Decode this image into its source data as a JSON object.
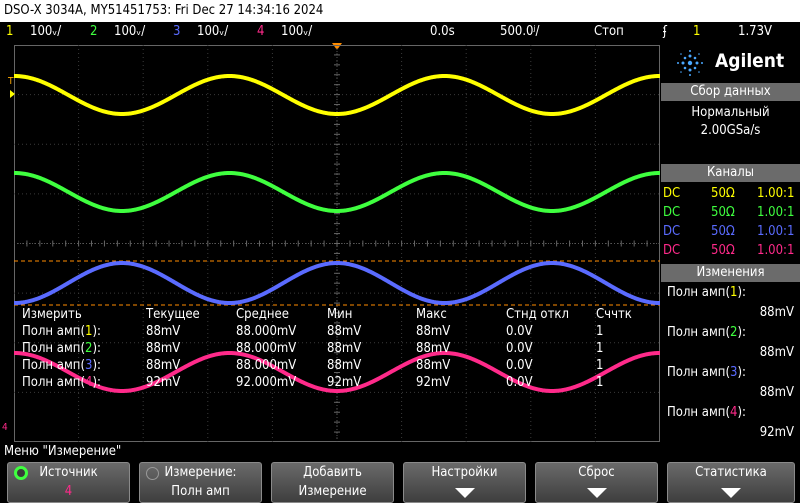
{
  "title": "DSO-X 3034A, MY51451753: Fri Dec 27 14:34:16 2024",
  "status": {
    "ch1_num": "1",
    "ch1_scale": "100ᵥ/",
    "ch2_num": "2",
    "ch2_scale": "100ᵥ/",
    "ch3_num": "3",
    "ch3_scale": "100ᵥ/",
    "ch4_num": "4",
    "ch4_scale": "100ᵥ/",
    "time_pos": "0.0s",
    "time_scale": "500.0ʲ/",
    "run_state": "Стоп",
    "trig_icon": "ʄ",
    "trig_src": "1",
    "trig_level": "1.73V"
  },
  "colors": {
    "ch1": "#ffff00",
    "ch2": "#3fff3f",
    "ch3": "#5a6bff",
    "ch4": "#ff2a8a",
    "trigger_marker": "#ff8c00",
    "panel_header": "#6b6b6b"
  },
  "side_panel": {
    "logo": "Agilent",
    "acq_header": "Сбор данных",
    "acq_mode": "Нормальный",
    "acq_rate": "2.00GSa/s",
    "channels_header": "Каналы",
    "channels": [
      {
        "coupling": "DC",
        "imp": "50Ω",
        "probe": "1.00:1"
      },
      {
        "coupling": "DC",
        "imp": "50Ω",
        "probe": "1.00:1"
      },
      {
        "coupling": "DC",
        "imp": "50Ω",
        "probe": "1.00:1"
      },
      {
        "coupling": "DC",
        "imp": "50Ω",
        "probe": "1.00:1"
      }
    ],
    "meas_header": "Изменения",
    "meas_items": [
      {
        "label": "Полн амп",
        "ch": "1",
        "value": "88mV"
      },
      {
        "label": "Полн амп",
        "ch": "2",
        "value": "88mV"
      },
      {
        "label": "Полн амп",
        "ch": "3",
        "value": "88mV"
      },
      {
        "label": "Полн амп",
        "ch": "4",
        "value": "92mV"
      }
    ]
  },
  "meas_table": {
    "headers": [
      "Измерить",
      "Текущее",
      "Среднее",
      "Мин",
      "Макс",
      "Стнд откл",
      "Сччтк"
    ],
    "rows": [
      {
        "label": "Полн амп",
        "ch": "1",
        "cur": "88mV",
        "avg": "88.000mV",
        "min": "88mV",
        "max": "88mV",
        "std": "0.0V",
        "cnt": "1"
      },
      {
        "label": "Полн амп",
        "ch": "2",
        "cur": "88mV",
        "avg": "88.000mV",
        "min": "88mV",
        "max": "88mV",
        "std": "0.0V",
        "cnt": "1"
      },
      {
        "label": "Полн амп",
        "ch": "3",
        "cur": "88mV",
        "avg": "88.000mV",
        "min": "88mV",
        "max": "88mV",
        "std": "0.0V",
        "cnt": "1"
      },
      {
        "label": "Полн амп",
        "ch": "4",
        "cur": "92mV",
        "avg": "92.000mV",
        "min": "92mV",
        "max": "92mV",
        "std": "0.0V",
        "cnt": "1"
      }
    ]
  },
  "menu_title": "Меню \"Измерение\"",
  "softkeys": [
    {
      "line1": "Источник",
      "line2": "4"
    },
    {
      "line1": "Измерение:",
      "line2": "Полн амп"
    },
    {
      "line1": "Добавить",
      "line2": "Измерение"
    },
    {
      "line1": "Настройки",
      "line2": ""
    },
    {
      "line1": "Сброс",
      "line2": ""
    },
    {
      "line1": "Статистика",
      "line2": ""
    }
  ]
}
